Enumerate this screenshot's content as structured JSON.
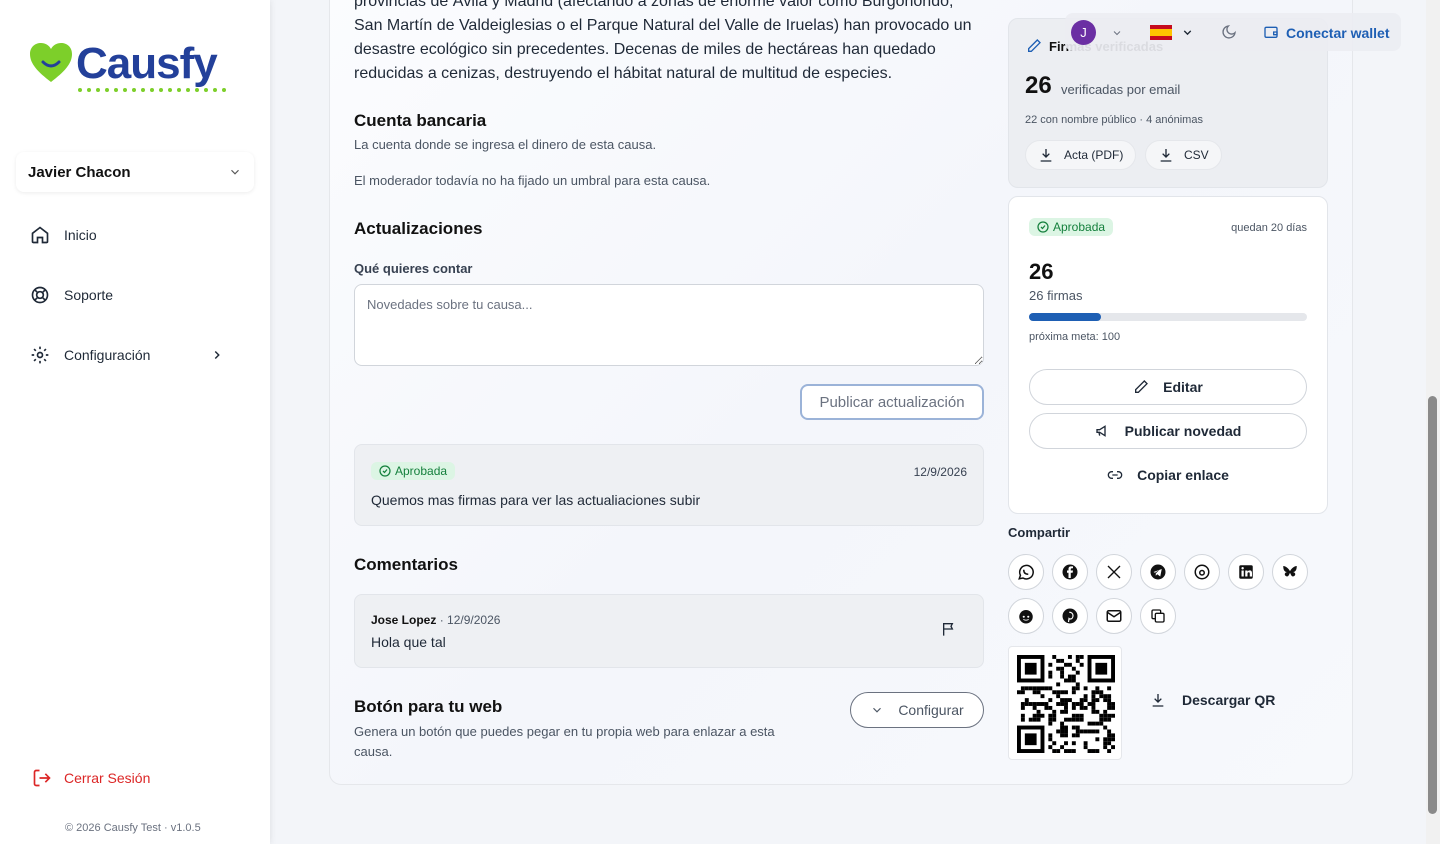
{
  "sidebar": {
    "logo_text": "Causfy",
    "user_name": "Javier Chacon",
    "nav": [
      {
        "label": "Inicio"
      },
      {
        "label": "Soporte"
      },
      {
        "label": "Configuración"
      }
    ],
    "logout_label": "Cerrar Sesión",
    "copyright": "© 2026 Causfy Test · v1.0.5"
  },
  "topbar": {
    "avatar_letter": "J",
    "connect_wallet": "Conectar wallet"
  },
  "main": {
    "intro_text": "provincias de Ávila y Madrid (afectando a zonas de enorme valor como Burgohondo, San Martín de Valdeiglesias o el Parque Natural del Valle de Iruelas) han provocado un desastre ecológico sin precedentes. Decenas de miles de hectáreas han quedado reducidas a cenizas, destruyendo el hábitat natural de multitud de especies.",
    "bank": {
      "title": "Cuenta bancaria",
      "desc": "La cuenta donde se ingresa el dinero de esta causa.",
      "note": "El moderador todavía no ha fijado un umbral para esta causa."
    },
    "updates": {
      "title": "Actualizaciones",
      "field_label": "Qué quieres contar",
      "placeholder": "Novedades sobre tu causa...",
      "publish_button": "Publicar actualización",
      "items": [
        {
          "status": "Aprobada",
          "date": "12/9/2026",
          "text": "Quemos mas firmas para ver las actualiaciones subir"
        }
      ]
    },
    "comments": {
      "title": "Comentarios",
      "items": [
        {
          "author": "Jose Lopez",
          "date": "· 12/9/2026",
          "text": "Hola que tal"
        }
      ]
    },
    "web_button": {
      "title": "Botón para tu web",
      "desc": "Genera un botón que puedes pegar en tu propia web para enlazar a esta causa.",
      "configure": "Configurar"
    }
  },
  "signatures_card": {
    "title": "Firmas verificadas",
    "count": "26",
    "count_label": "verificadas por email",
    "breakdown": "22 con nombre público · 4 anónimas",
    "acta_button": "Acta (PDF)",
    "csv_button": "CSV"
  },
  "status_card": {
    "status": "Aprobada",
    "remaining": "quedan 20 días",
    "count": "26",
    "count_label": "26 firmas",
    "progress": 0.26,
    "next_goal": "próxima meta: 100",
    "edit_button": "Editar",
    "publish_news_button": "Publicar novedad",
    "copy_link_button": "Copiar enlace"
  },
  "share": {
    "title": "Compartir",
    "icons": [
      "whatsapp-icon",
      "facebook-icon",
      "x-icon",
      "telegram-icon",
      "threads-icon",
      "linkedin-icon",
      "bluesky-icon",
      "reddit-icon",
      "pinterest-icon",
      "email-icon",
      "copy-icon"
    ],
    "download_qr": "Descargar QR"
  },
  "colors": {
    "brand_blue": "#23409a",
    "brand_green": "#7dcf2a",
    "accent_blue": "#1e5fb4",
    "success_green": "#15803d",
    "danger_red": "#dc2626"
  }
}
